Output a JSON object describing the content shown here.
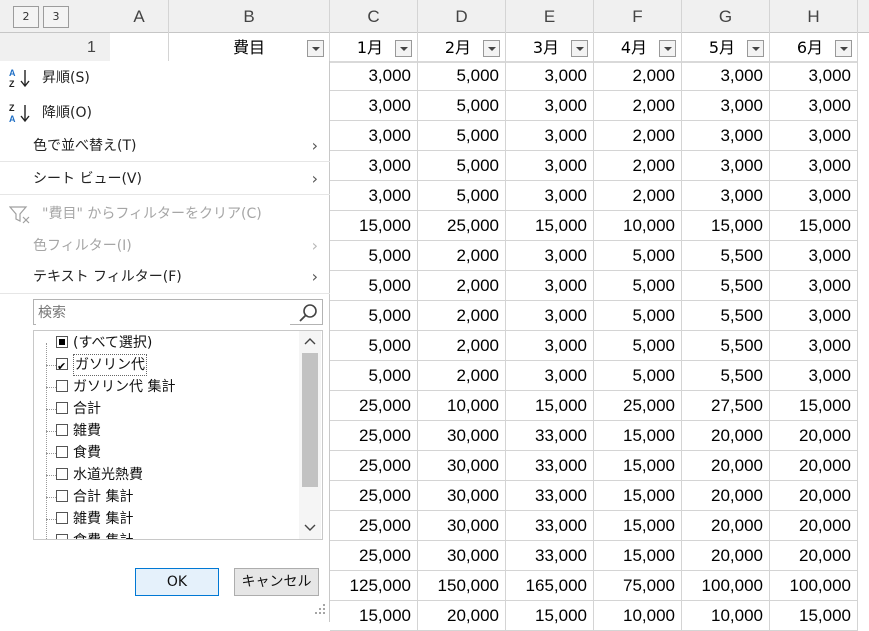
{
  "outline_levels": [
    "2",
    "3"
  ],
  "columns": [
    "A",
    "B",
    "C",
    "D",
    "E",
    "F",
    "G",
    "H"
  ],
  "row1_label": "1",
  "header_b": "費目",
  "months": [
    "1月",
    "2月",
    "3月",
    "4月",
    "5月",
    "6月"
  ],
  "rows": [
    [
      "3,000",
      "5,000",
      "3,000",
      "2,000",
      "3,000",
      "3,000"
    ],
    [
      "3,000",
      "5,000",
      "3,000",
      "2,000",
      "3,000",
      "3,000"
    ],
    [
      "3,000",
      "5,000",
      "3,000",
      "2,000",
      "3,000",
      "3,000"
    ],
    [
      "3,000",
      "5,000",
      "3,000",
      "2,000",
      "3,000",
      "3,000"
    ],
    [
      "3,000",
      "5,000",
      "3,000",
      "2,000",
      "3,000",
      "3,000"
    ],
    [
      "15,000",
      "25,000",
      "15,000",
      "10,000",
      "15,000",
      "15,000"
    ],
    [
      "5,000",
      "2,000",
      "3,000",
      "5,000",
      "5,500",
      "3,000"
    ],
    [
      "5,000",
      "2,000",
      "3,000",
      "5,000",
      "5,500",
      "3,000"
    ],
    [
      "5,000",
      "2,000",
      "3,000",
      "5,000",
      "5,500",
      "3,000"
    ],
    [
      "5,000",
      "2,000",
      "3,000",
      "5,000",
      "5,500",
      "3,000"
    ],
    [
      "5,000",
      "2,000",
      "3,000",
      "5,000",
      "5,500",
      "3,000"
    ],
    [
      "25,000",
      "10,000",
      "15,000",
      "25,000",
      "27,500",
      "15,000"
    ],
    [
      "25,000",
      "30,000",
      "33,000",
      "15,000",
      "20,000",
      "20,000"
    ],
    [
      "25,000",
      "30,000",
      "33,000",
      "15,000",
      "20,000",
      "20,000"
    ],
    [
      "25,000",
      "30,000",
      "33,000",
      "15,000",
      "20,000",
      "20,000"
    ],
    [
      "25,000",
      "30,000",
      "33,000",
      "15,000",
      "20,000",
      "20,000"
    ],
    [
      "25,000",
      "30,000",
      "33,000",
      "15,000",
      "20,000",
      "20,000"
    ],
    [
      "125,000",
      "150,000",
      "165,000",
      "75,000",
      "100,000",
      "100,000"
    ],
    [
      "15,000",
      "20,000",
      "15,000",
      "10,000",
      "10,000",
      "15,000"
    ]
  ],
  "menu": {
    "sort_asc": "昇順(S)",
    "sort_desc": "降順(O)",
    "sort_by_color": "色で並べ替え(T)",
    "sheet_view": "シート ビュー(V)",
    "clear_filter": "\"費目\" からフィルターをクリア(C)",
    "color_filter": "色フィルター(I)",
    "text_filter": "テキスト フィルター(F)",
    "search_placeholder": "検索",
    "list_items": [
      "(すべて選択)",
      "ガソリン代",
      "ガソリン代 集計",
      "合計",
      "雑費",
      "食費",
      "水道光熱費",
      "合計 集計",
      "雑費 集計",
      "食費 集計"
    ],
    "ok": "OK",
    "cancel": "キャンセル"
  },
  "colors": {
    "accent": "#0078d4",
    "az_blue": "#1f6fc5"
  }
}
